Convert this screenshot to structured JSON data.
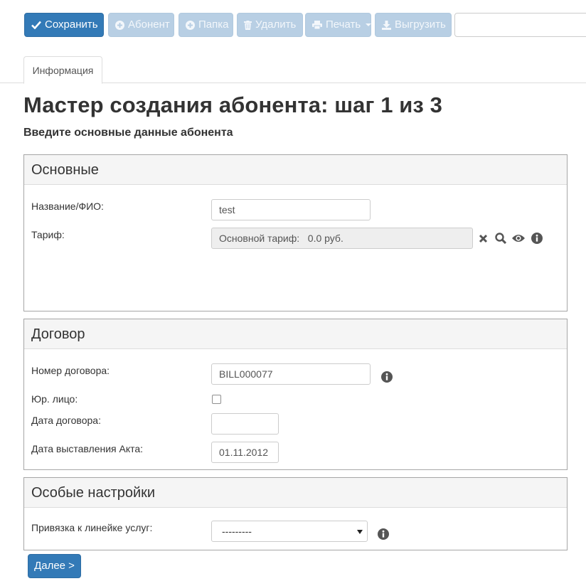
{
  "toolbar": {
    "save_label": "Сохранить",
    "subscriber_label": "Абонент",
    "folder_label": "Папка",
    "delete_label": "Удалить",
    "print_label": "Печать",
    "export_label": "Выгрузить"
  },
  "tabs": [
    {
      "label": "Информация"
    }
  ],
  "page": {
    "title": "Мастер создания абонента: шаг 1 из 3",
    "subtitle": "Введите основные данные абонента"
  },
  "sections": {
    "basic": {
      "title": "Основные",
      "name_label": "Название/ФИО:",
      "name_value": "test",
      "tariff_label": "Тариф:",
      "tariff_value": "Основной тариф:   0.0 руб."
    },
    "contract": {
      "title": "Договор",
      "number_label": "Номер договора:",
      "number_value": "BILL000077",
      "legal_label": "Юр. лицо:",
      "legal_checked": false,
      "date_label": "Дата договора:",
      "date_value": "",
      "act_date_label": "Дата выставления Акта:",
      "act_date_value": "01.11.2012"
    },
    "special": {
      "title": "Особые настройки",
      "service_line_label": "Привязка к линейке услуг:",
      "service_line_value": "---------"
    }
  },
  "footer": {
    "next_label": "Далее >"
  },
  "colors": {
    "primary": "#337ab7",
    "disabled": "#b8cfe4",
    "icon": "#555555"
  }
}
